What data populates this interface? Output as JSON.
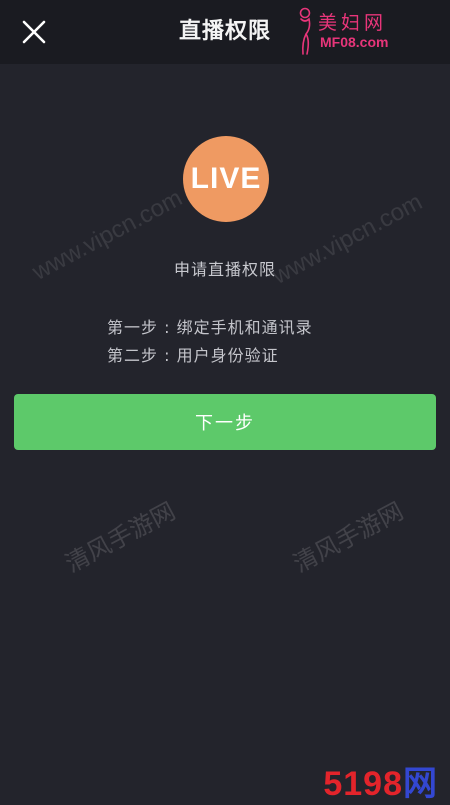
{
  "header": {
    "title": "直播权限",
    "close_icon": "close-icon"
  },
  "logo": {
    "cn": "美妇网",
    "en": "MF08.com",
    "color": "#e8357a"
  },
  "live_badge": {
    "text": "LIVE",
    "color": "#ef9a62"
  },
  "main": {
    "apply_title": "申请直播权限",
    "steps": [
      "第一步 : 绑定手机和通讯录",
      "第二步 : 用户身份验证"
    ],
    "next_button": "下一步",
    "next_button_color": "#5dc96a"
  },
  "watermarks": {
    "vip_left": "www.vipcn.com",
    "vip_right": "www.vipcn.com",
    "qf_left": "清风手游网",
    "qf_right": "清风手游网"
  },
  "corner_brand": {
    "digits": "5198",
    "cn": "网",
    "digits_color": "#e3242b",
    "cn_color": "#3347d1"
  }
}
